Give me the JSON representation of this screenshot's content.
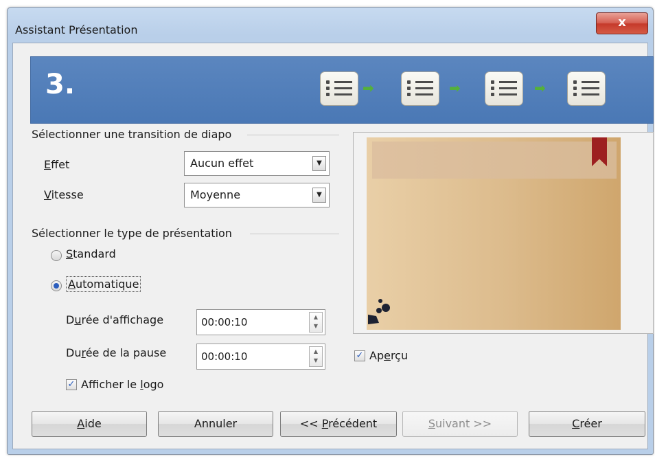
{
  "window": {
    "title": "Assistant Présentation",
    "close_label": "x"
  },
  "banner": {
    "step": "3."
  },
  "transition": {
    "group_title": "Sélectionner une transition de diapo",
    "effect_label_first": "E",
    "effect_label_rest": "ffet",
    "effect_value": "Aucun effet",
    "speed_label_first": "V",
    "speed_label_rest": "itesse",
    "speed_value": "Moyenne"
  },
  "presentation_type": {
    "group_title": "Sélectionner le type de présentation",
    "standard_first": "S",
    "standard_rest": "tandard",
    "standard_checked": false,
    "automatic_first": "A",
    "automatic_rest": "utomatique",
    "automatic_checked": true,
    "duration_pre": "D",
    "duration_key": "u",
    "duration_post": "rée d'affichage",
    "duration_value": "00:00:10",
    "pause_pre": "Du",
    "pause_key": "r",
    "pause_post": "ée de la pause",
    "pause_value": "00:00:10",
    "logo_pre": "Afficher le ",
    "logo_key": "l",
    "logo_post": "ogo",
    "logo_checked": true
  },
  "preview": {
    "label_pre": "Ap",
    "label_key": "e",
    "label_post": "rçu",
    "checked": true
  },
  "buttons": {
    "help_key": "A",
    "help_rest": "ide",
    "cancel": "Annuler",
    "previous_pre": "<< ",
    "previous_key": "P",
    "previous_post": "récédent",
    "next_key": "S",
    "next_rest": "uivant >>",
    "create_key": "C",
    "create_rest": "réer"
  },
  "colors": {
    "banner": "#4a78b5",
    "arrow": "#54b03a",
    "close": "#c53a2b"
  }
}
